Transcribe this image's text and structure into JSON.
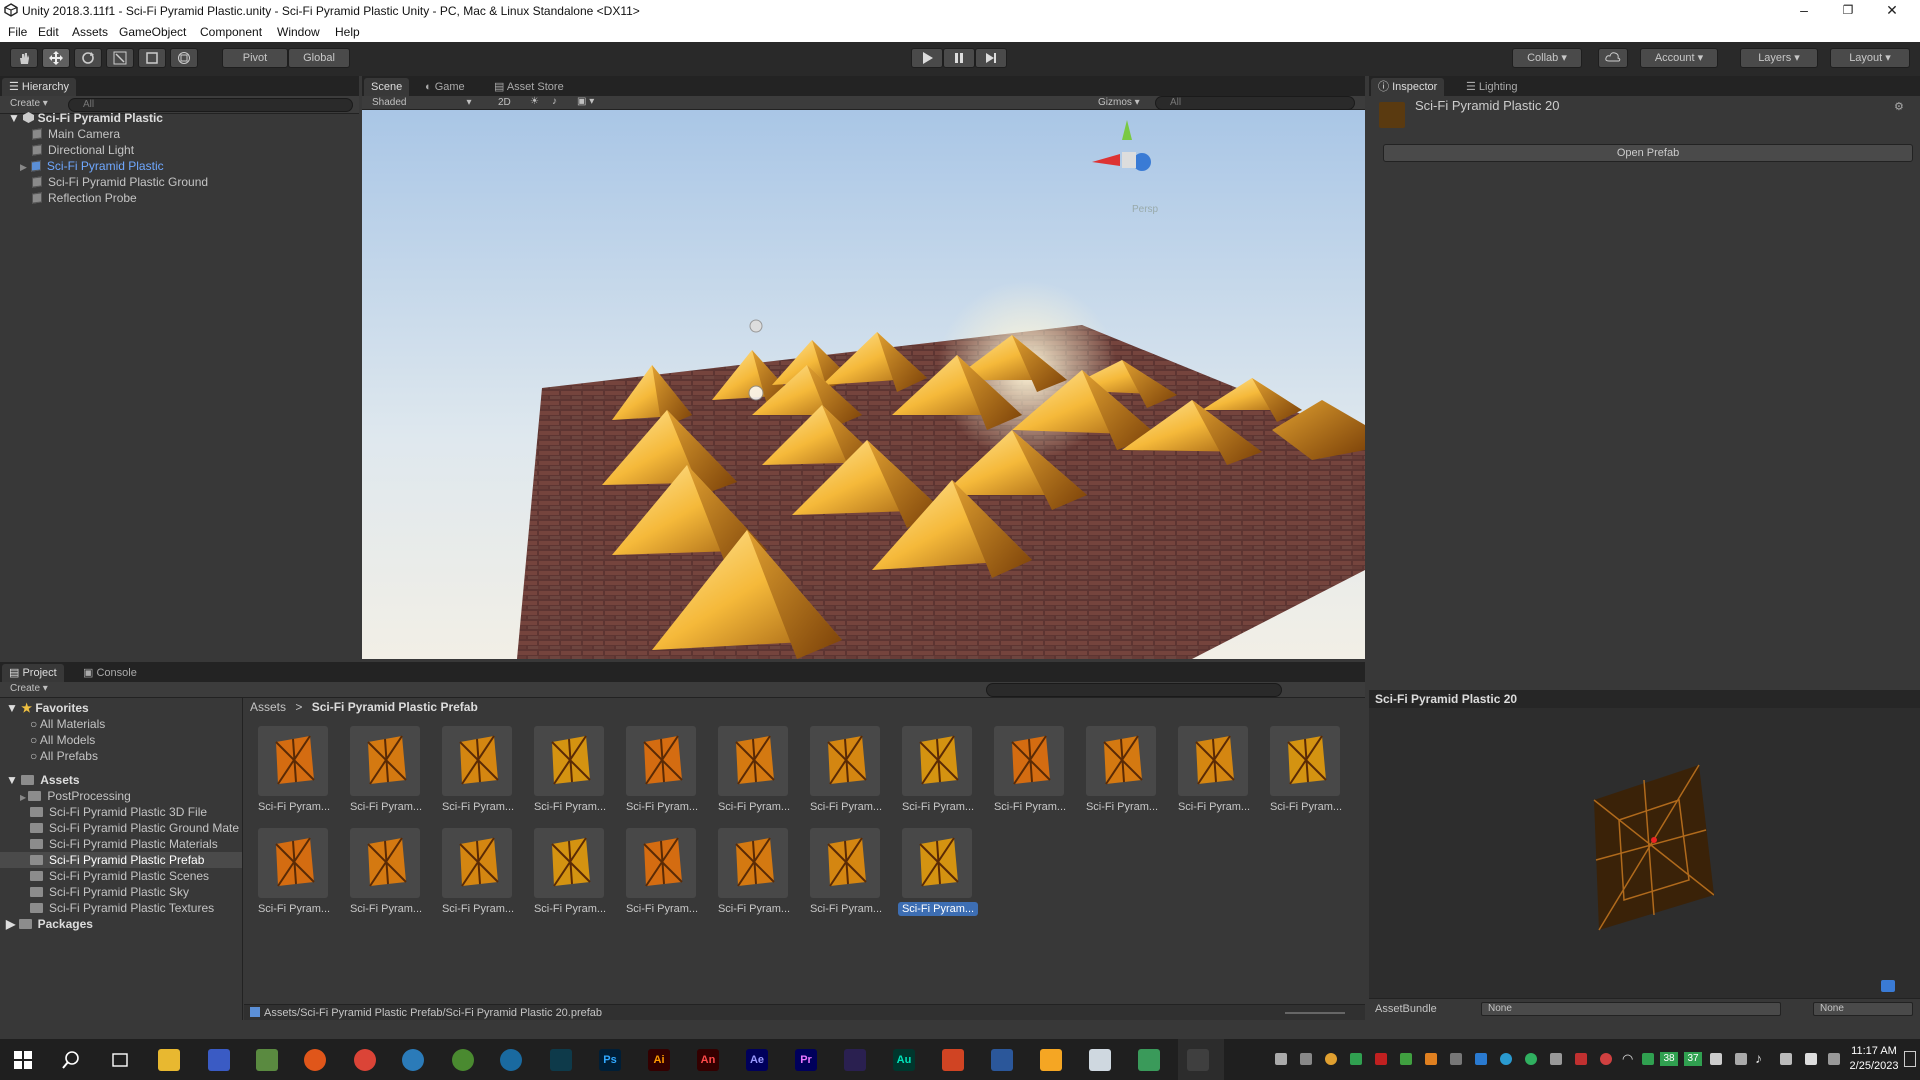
{
  "window": {
    "title": "Unity 2018.3.11f1 - Sci-Fi Pyramid Plastic.unity - Sci-Fi Pyramid Plastic Unity - PC, Mac & Linux Standalone <DX11>",
    "minimize": "–",
    "maximize": "❐",
    "close": "✕"
  },
  "menu": [
    "File",
    "Edit",
    "Assets",
    "GameObject",
    "Component",
    "Window",
    "Help"
  ],
  "toolbar": {
    "pivot": "Pivot",
    "global": "Global",
    "collab": "Collab",
    "account": "Account",
    "layers": "Layers",
    "layout": "Layout"
  },
  "hierarchy": {
    "tab": "Hierarchy",
    "create": "Create",
    "search_placeholder": "All",
    "scene": "Sci-Fi Pyramid Plastic",
    "items": [
      "Main Camera",
      "Directional Light",
      "Sci-Fi Pyramid Plastic",
      "Sci-Fi Pyramid Plastic Ground",
      "Reflection Probe"
    ]
  },
  "scene": {
    "tabs": [
      "Scene",
      "Game",
      "Asset Store"
    ],
    "shading": "Shaded",
    "mode_2d": "2D",
    "gizmos": "Gizmos",
    "search_placeholder": "All",
    "persp": "Persp"
  },
  "inspector": {
    "tabs": [
      "Inspector",
      "Lighting"
    ],
    "object_name": "Sci-Fi Pyramid Plastic 20",
    "open_prefab": "Open Prefab",
    "preview_title": "Sci-Fi Pyramid Plastic 20",
    "assetbundle_label": "AssetBundle",
    "assetbundle_value": "None",
    "variant_value": "None"
  },
  "project": {
    "tabs": [
      "Project",
      "Console"
    ],
    "create": "Create",
    "favorites_label": "Favorites",
    "favorites": [
      "All Materials",
      "All Models",
      "All Prefabs"
    ],
    "assets_label": "Assets",
    "folders": [
      "PostProcessing",
      "Sci-Fi Pyramid Plastic 3D File",
      "Sci-Fi Pyramid Plastic Ground Mate",
      "Sci-Fi Pyramid Plastic Materials",
      "Sci-Fi Pyramid Plastic Prefab",
      "Sci-Fi Pyramid Plastic Scenes",
      "Sci-Fi Pyramid Plastic Sky",
      "Sci-Fi Pyramid Plastic Textures"
    ],
    "packages_label": "Packages",
    "breadcrumb_root": "Assets",
    "breadcrumb_sep": ">",
    "breadcrumb_current": "Sci-Fi Pyramid Plastic Prefab",
    "asset_label": "Sci-Fi Pyram...",
    "asset_count_row1": 12,
    "asset_count_row2": 8,
    "selected_index": 19,
    "status_path": "Assets/Sci-Fi Pyramid Plastic Prefab/Sci-Fi Pyramid Plastic 20.prefab"
  },
  "taskbar": {
    "time": "11:17 AM",
    "date": "2/25/2023",
    "tray_numbers": [
      "38",
      "37"
    ],
    "apps": [
      "Ps",
      "Ai",
      "An",
      "Ae",
      "Pr",
      "Au"
    ]
  },
  "colors": {
    "accent": "#3d6eb3",
    "selected_text": "#6fa8ff",
    "panel_bg": "#383838",
    "tab_bg": "#232323"
  }
}
